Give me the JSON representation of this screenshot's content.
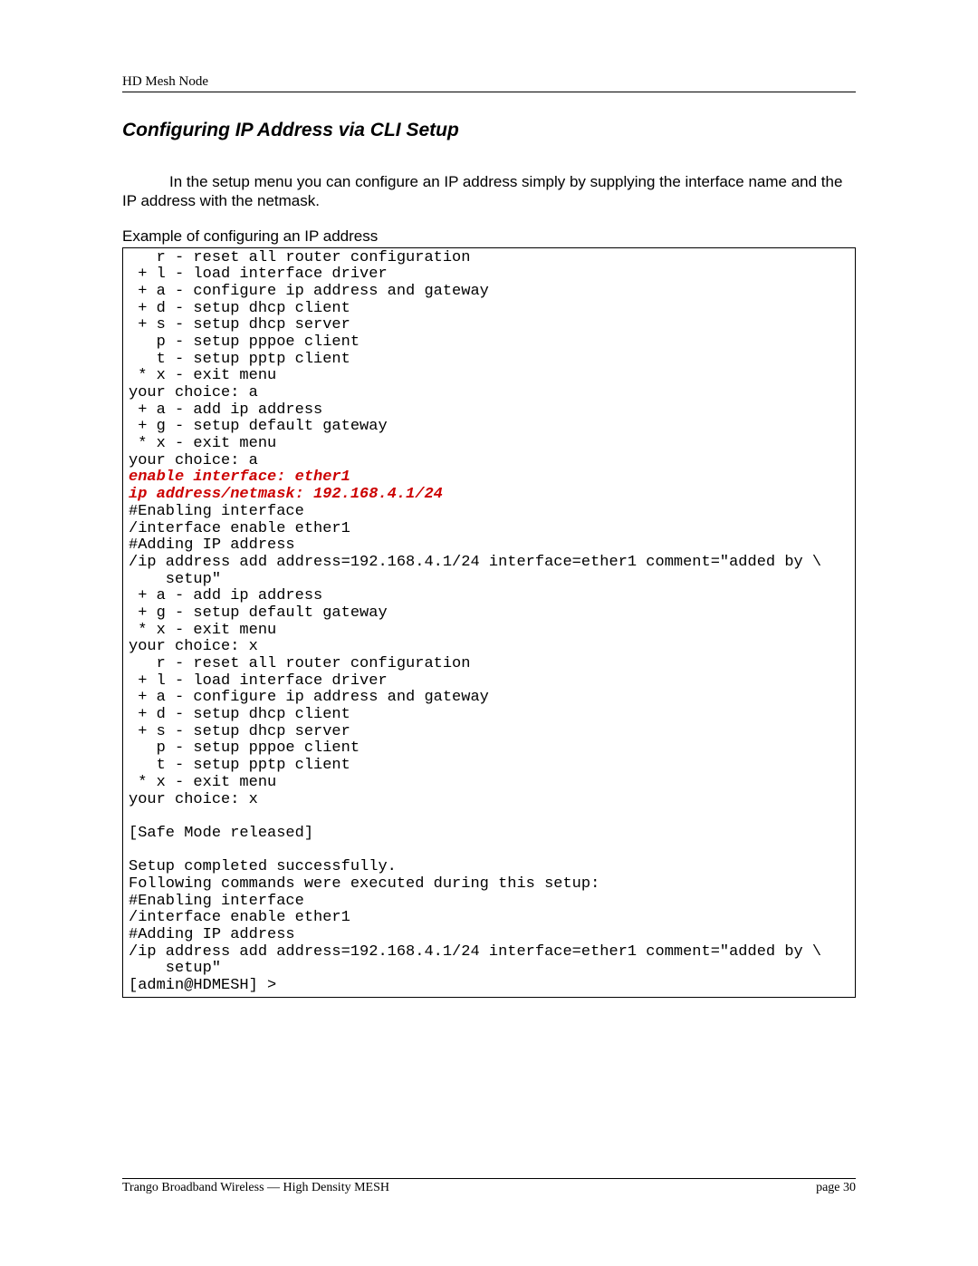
{
  "header": {
    "running_head": "HD Mesh Node"
  },
  "section": {
    "title": "Configuring IP Address via CLI Setup",
    "paragraph": "In the setup menu you can configure an IP address simply by supplying the interface name and the IP address with the netmask.",
    "example_label": "Example of configuring an IP address"
  },
  "code": {
    "pre1": "   r - reset all router configuration\n + l - load interface driver\n + a - configure ip address and gateway\n + d - setup dhcp client\n + s - setup dhcp server\n   p - setup pppoe client\n   t - setup pptp client\n * x - exit menu\nyour choice: a\n + a - add ip address\n + g - setup default gateway\n * x - exit menu\nyour choice: a",
    "red1": "enable interface: ether1",
    "red2": "ip address/netmask: 192.168.4.1/24",
    "pre2": "#Enabling interface\n/interface enable ether1\n#Adding IP address\n/ip address add address=192.168.4.1/24 interface=ether1 comment=\"added by \\\n    setup\"\n + a - add ip address\n + g - setup default gateway\n * x - exit menu\nyour choice: x\n   r - reset all router configuration\n + l - load interface driver\n + a - configure ip address and gateway\n + d - setup dhcp client\n + s - setup dhcp server\n   p - setup pppoe client\n   t - setup pptp client\n * x - exit menu\nyour choice: x\n\n[Safe Mode released]\n\nSetup completed successfully.\nFollowing commands were executed during this setup:\n#Enabling interface\n/interface enable ether1\n#Adding IP address\n/ip address add address=192.168.4.1/24 interface=ether1 comment=\"added by \\\n    setup\"\n[admin@HDMESH] >"
  },
  "footer": {
    "left": "Trango Broadband Wireless — High Density MESH",
    "right": "page 30"
  }
}
